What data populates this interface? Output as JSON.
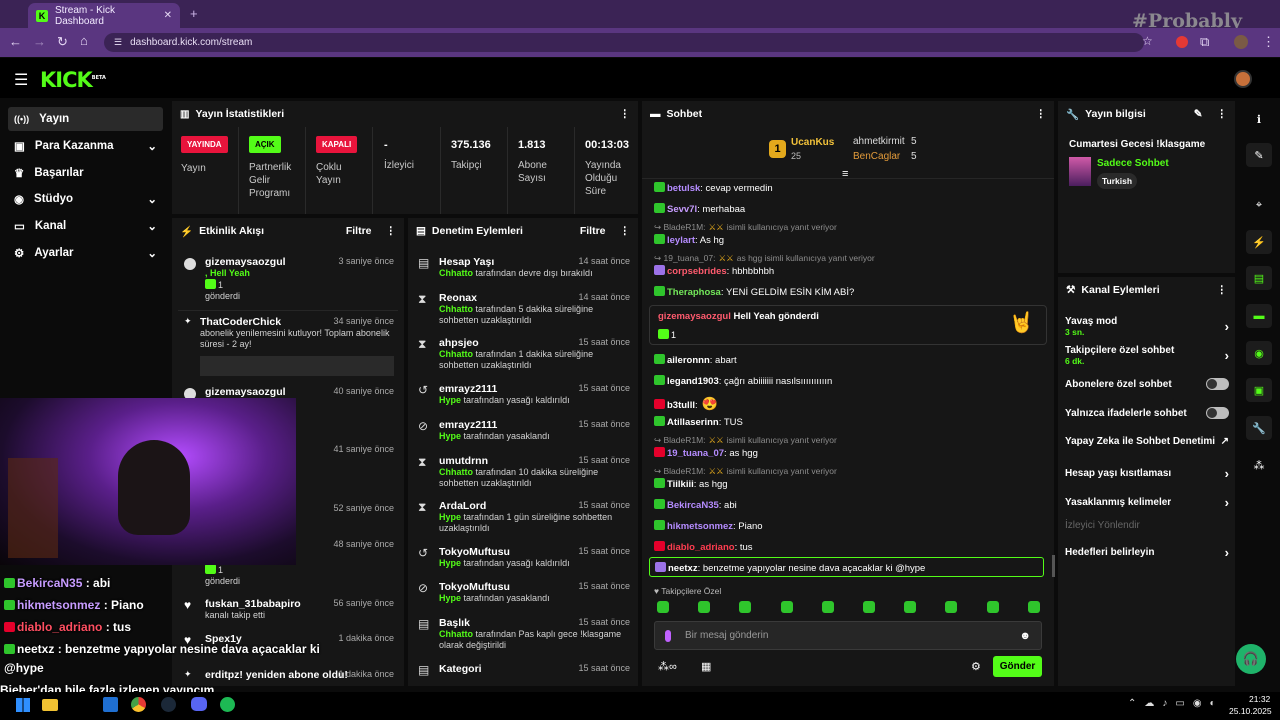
{
  "browser": {
    "tab_title": "Stream - Kick Dashboard",
    "url": "dashboard.kick.com/stream",
    "watermark": "#Probably"
  },
  "sidebar": {
    "items": [
      {
        "label": "Yayın",
        "icon": "broadcast-icon"
      },
      {
        "label": "Para Kazanma",
        "icon": "money-icon"
      },
      {
        "label": "Başarılar",
        "icon": "trophy-icon"
      },
      {
        "label": "Stüdyo",
        "icon": "studio-icon"
      },
      {
        "label": "Kanal",
        "icon": "channel-icon"
      },
      {
        "label": "Ayarlar",
        "icon": "gear-icon"
      }
    ]
  },
  "stats": {
    "title": "Yayın İstatistikleri",
    "badges": [
      {
        "badge": "YAYINDA",
        "label": "Yayın",
        "color": "#e8143c"
      },
      {
        "badge": "AÇIK",
        "label": "Partnerlik Gelir Programı",
        "color": "#53fc18"
      },
      {
        "badge": "KAPALI",
        "label": "Çoklu Yayın",
        "color": "#e8143c"
      }
    ],
    "items": [
      {
        "value": "-",
        "label": "İzleyici"
      },
      {
        "value": "375.136",
        "label": "Takipçi"
      },
      {
        "value": "1.813",
        "label": "Abone Sayısı"
      },
      {
        "value": "00:13:03",
        "label": "Yayında Olduğu Süre"
      }
    ]
  },
  "activity": {
    "title": "Etkinlik Akışı",
    "filter": "Filtre",
    "events": [
      {
        "name": "gizemaysaozgul",
        "time": "3 saniye önce",
        "l1": ", Hell Yeah",
        "l2": "1",
        "l3": "gönderdi"
      },
      {
        "name": "ThatCoderChick",
        "time": "34 saniye önce",
        "l1": "abonelik yenilemesini kutluyor! Toplam abonelik",
        "l2": "süresi - 2 ay!"
      },
      {
        "name": "gizemaysaozgul",
        "time": "40 saniye önce"
      },
      {
        "time": "41 saniye önce"
      },
      {
        "time": "52 saniye önce"
      },
      {
        "time": "48 saniye önce",
        "l2": "1",
        "l3": "gönderdi"
      },
      {
        "name": "fuskan_31babapiro",
        "time": "56 saniye önce",
        "l1": "kanalı takip etti"
      },
      {
        "name": "Spex1y",
        "time": "1 dakika önce"
      },
      {
        "name": "erditpz! yeniden abone oldu!",
        "time": "1 dakika önce"
      }
    ]
  },
  "moderation": {
    "title": "Denetim Eylemleri",
    "filter": "Filtre",
    "items": [
      {
        "name": "Hesap Yaşı",
        "time": "14 saat önce",
        "who": "Chhatto",
        "text": " tarafından devre dışı bırakıldı"
      },
      {
        "name": "Reonax",
        "time": "14 saat önce",
        "who": "Chhatto",
        "text": " tarafından 5 dakika süreliğine sohbetten uzaklaştırıldı"
      },
      {
        "name": "ahpsjeo",
        "time": "15 saat önce",
        "who": "Chhatto",
        "text": " tarafından 1 dakika süreliğine sohbetten uzaklaştırıldı"
      },
      {
        "name": "emrayz2111",
        "time": "15 saat önce",
        "who": "Hype",
        "text": " tarafından yasağı kaldırıldı"
      },
      {
        "name": "emrayz2111",
        "time": "15 saat önce",
        "who": "Hype",
        "text": " tarafından yasaklandı"
      },
      {
        "name": "umutdrnn",
        "time": "15 saat önce",
        "who": "Chhatto",
        "text": " tarafından 10 dakika süreliğine sohbetten uzaklaştırıldı"
      },
      {
        "name": "ArdaLord",
        "time": "15 saat önce",
        "who": "Hype",
        "text": " tarafından 1 gün süreliğine sohbetten uzaklaştırıldı"
      },
      {
        "name": "TokyoMuftusu",
        "time": "15 saat önce",
        "who": "Hype",
        "text": " tarafından yasağı kaldırıldı"
      },
      {
        "name": "TokyoMuftusu",
        "time": "15 saat önce",
        "who": "Hype",
        "text": " tarafından yasaklandı"
      },
      {
        "name": "Başlık",
        "time": "15 saat önce",
        "who": "Chhatto",
        "text": " tarafından Pas kaplı gece !klasgame olarak değiştirildi"
      },
      {
        "name": "Kategori",
        "time": "15 saat önce"
      }
    ]
  },
  "chat": {
    "title": "Sohbet",
    "leaders": [
      {
        "name": "UcanKus",
        "score": "25",
        "rank": "1"
      },
      {
        "name": "ahmetkirmit",
        "score": "5"
      },
      {
        "name": "BenCaglar",
        "score": "5"
      }
    ],
    "messages": [
      {
        "user": "betulsk",
        "text": ": cevap vermedin",
        "color": "#b58cff"
      },
      {
        "user": "Sevv7l",
        "text": ": merhabaa",
        "color": "#c79cff"
      },
      {
        "reply": "BladeR1M:",
        "reply_text": "isimli kullanıcıya yanıt veriyor"
      },
      {
        "user": "leylart",
        "text": ": As hg",
        "color": "#b58cff"
      },
      {
        "reply": "19_tuana_07:",
        "reply_text": "as hgg isimli kullanıcıya yanıt veriyor"
      },
      {
        "user": "corpsebrides",
        "text": ": hbhbbhbh",
        "color": "#ff5b6e"
      },
      {
        "user": "Theraphosa",
        "text": ": YENİ GELDİM ESİN KİM ABİ?",
        "color": "#73e85a"
      },
      {
        "user": "aileronnn",
        "text": ": abart",
        "color": "#ffffff"
      },
      {
        "user": "legand1903",
        "text": ": çağrı abiiiiiii nasılsıııııııııın",
        "color": "#ffffff"
      },
      {
        "user": "b3tulll",
        "text": ":",
        "color": "#ffffff"
      },
      {
        "user": "Atillaserinn",
        "text": ": TUS",
        "color": "#ffffff"
      },
      {
        "reply": "BladeR1M:",
        "reply_text": "isimli kullanıcıya yanıt veriyor"
      },
      {
        "user": "19_tuana_07",
        "text": ": as hgg",
        "color": "#b58cff"
      },
      {
        "reply": "BladeR1M:",
        "reply_text": "isimli kullanıcıya yanıt veriyor"
      },
      {
        "user": "Tiilkiii",
        "text": ": as hgg",
        "color": "#ffffff"
      },
      {
        "user": "BekircaN35",
        "text": ": abi",
        "color": "#b58cff"
      },
      {
        "user": "hikmetsonmez",
        "text": ": Piano",
        "color": "#b58cff"
      },
      {
        "user": "diablo_adriano",
        "text": ": tus",
        "color": "#ff3d50"
      }
    ],
    "gift": {
      "user": "gizemaysaozgul",
      "text": " Hell Yeah gönderdi",
      "count": "1"
    },
    "highlight": {
      "user": "neetxz",
      "text": ": benzetme yapıyolar nesine dava açacaklar ki @hype"
    },
    "followers_only": "Takipçilere Özel",
    "placeholder": "Bir mesaj gönderin",
    "send": "Gönder"
  },
  "info": {
    "title": "Yayın bilgisi",
    "stream_title": "Cumartesi Gecesi !klasgame",
    "category": "Sadece Sohbet",
    "tag": "Turkish"
  },
  "channel_actions": {
    "title": "Kanal Eylemleri",
    "items": [
      {
        "label": "Yavaş mod",
        "sub": "3 sn.",
        "kind": "chevron"
      },
      {
        "label": "Takipçilere özel sohbet",
        "sub": "6 dk.",
        "kind": "chevron"
      },
      {
        "label": "Abonelere özel sohbet",
        "kind": "toggle"
      },
      {
        "label": "Yalnızca ifadelerle sohbet",
        "kind": "toggle"
      },
      {
        "label": "Yapay Zeka ile Sohbet Denetimi",
        "kind": "external"
      },
      {
        "label": "Hesap yaşı kısıtlaması",
        "kind": "chevron"
      },
      {
        "label": "Yasaklanmış kelimeler",
        "kind": "chevron"
      },
      {
        "label": "İzleyici Yönlendir",
        "kind": "disabled"
      },
      {
        "label": "Hedefleri belirleyin",
        "kind": "chevron"
      }
    ]
  },
  "overlay": {
    "lines": [
      {
        "user": "BekircaN35",
        "text": " : abi",
        "color": "#c79cff"
      },
      {
        "user": "hikmetsonmez",
        "text": " : Piano",
        "color": "#c79cff"
      },
      {
        "user": "diablo_adriano",
        "text": " : tus",
        "color": "#ff4f62"
      },
      {
        "user": "neetxz",
        "text": " : benzetme yapıyolar nesine dava açacaklar ki",
        "color": "#ffffff"
      }
    ],
    "hype": "@hype",
    "ticker": "Bieber'dan bile fazla izlenen yayıncım"
  },
  "taskbar": {
    "time": "21:32",
    "date": "25.10.2025"
  }
}
